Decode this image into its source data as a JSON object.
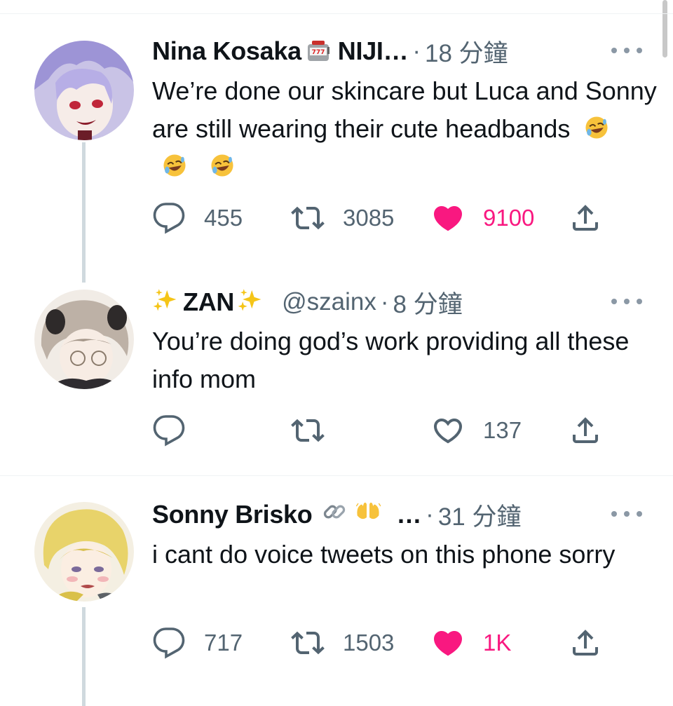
{
  "tweets": [
    {
      "display_name": "Nina Kosaka",
      "name_suffix": "NIJI…",
      "handle": "",
      "time": "18 分鐘",
      "text": "We’re done our skincare but Luca and Sonny are still wearing their cute headbands",
      "emojis_after_name": [
        "slot-machine-icon"
      ],
      "emojis_in_text": [
        "rofl-emoji-icon",
        "rofl-emoji-icon",
        "rofl-emoji-icon"
      ],
      "replies": "455",
      "retweets": "3085",
      "likes": "9100",
      "liked": true
    },
    {
      "display_name_prefix_emoji": "sparkles-icon",
      "display_name": "ZAN",
      "display_name_suffix_emoji": "sparkles-icon",
      "handle": "@szainx",
      "time": "8 分鐘",
      "text": "You’re doing god’s work providing all these info mom",
      "replies": "",
      "retweets": "",
      "likes": "137",
      "liked": false
    },
    {
      "display_name": "Sonny Brisko",
      "emojis_after_name": [
        "link-icon",
        "raising-hands-icon"
      ],
      "name_suffix": "…",
      "handle": "",
      "time": "31 分鐘",
      "text": "i cant do voice tweets on this phone sorry",
      "replies": "717",
      "retweets": "1503",
      "likes": "1K",
      "liked": true
    }
  ],
  "separator": "·",
  "colors": {
    "like_active": "#f91880",
    "muted": "#536471",
    "thread_line": "#cfd9de"
  }
}
